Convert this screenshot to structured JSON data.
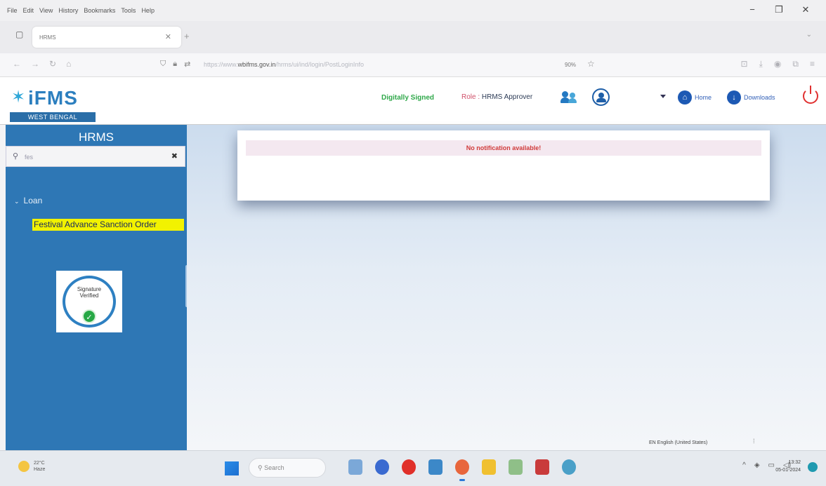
{
  "browser": {
    "menu": [
      "File",
      "Edit",
      "View",
      "History",
      "Bookmarks",
      "Tools",
      "Help"
    ],
    "tab_title": "HRMS",
    "url_prefix": "https://www.",
    "url_domain": "wbifms.gov.in",
    "url_path": "/hrms/ui/ind/login/PostLoginInfo",
    "zoom": "90%"
  },
  "header": {
    "logo_text": "iFMS",
    "logo_sub": "WEST BENGAL",
    "signed_text": "Digitally Signed",
    "role_label": "Role :",
    "role_value": "HRMS Approver",
    "home_label": "Home",
    "downloads_label": "Downloads"
  },
  "sidebar": {
    "title": "HRMS",
    "search_value": "fes",
    "group_label": "Loan",
    "menu_item": "Festival Advance Sanction Order",
    "signature_text_1": "Signature",
    "signature_text_2": "Verified"
  },
  "main": {
    "notification": "No notification available!",
    "language": "EN English (United States)"
  },
  "taskbar": {
    "temperature": "22°C",
    "weather": "Haze",
    "search_placeholder": "Search",
    "time": "13:32",
    "date": "05-01-2024"
  },
  "colors": {
    "sidebar": "#2e77b5",
    "highlight": "#f2f200",
    "signed": "#2fa84a",
    "notification_text": "#d03a3a"
  }
}
